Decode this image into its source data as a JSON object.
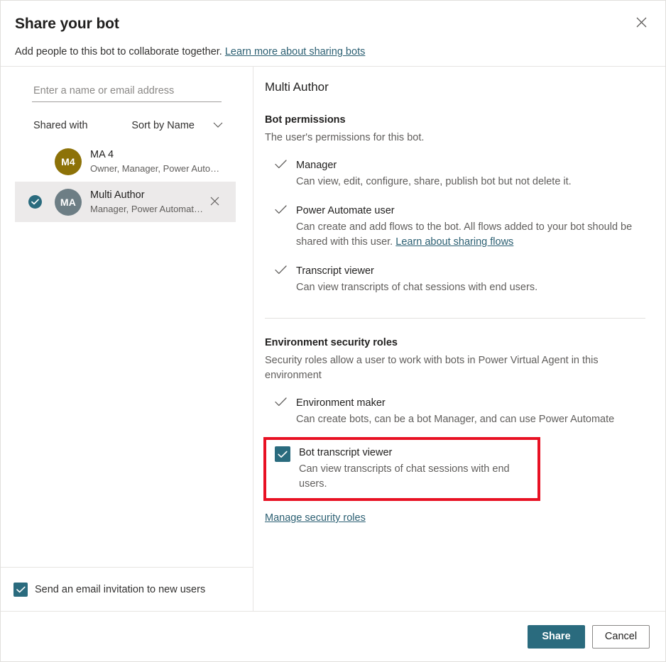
{
  "dialog": {
    "title": "Share your bot",
    "subtitle_text": "Add people to this bot to collaborate together.",
    "subtitle_link": "Learn more about sharing bots",
    "close_icon": "close-icon"
  },
  "left": {
    "people_input_placeholder": "Enter a name or email address",
    "people_input_value": "",
    "shared_with_label": "Shared with",
    "sort_label": "Sort by Name",
    "sort_chevron_icon": "chevron-down-icon",
    "people": [
      {
        "initials": "M4",
        "name": "MA 4",
        "roles": "Owner, Manager, Power Automate us...",
        "avatar_color": "#8d7208",
        "selected": false,
        "removable": false
      },
      {
        "initials": "MA",
        "name": "Multi Author",
        "roles": "Manager, Power Automate user",
        "avatar_color": "#6d7e85",
        "selected": true,
        "removable": true,
        "remove_icon": "close-icon"
      }
    ],
    "email_invite_label": "Send an email invitation to new users",
    "email_invite_checked": true
  },
  "right": {
    "user_title": "Multi Author",
    "bot_permissions": {
      "heading": "Bot permissions",
      "description": "The user's permissions for this bot.",
      "items": [
        {
          "name": "Manager",
          "description": "Can view, edit, configure, share, publish bot but not delete it.",
          "checked": true,
          "mark": "checkmark-icon"
        },
        {
          "name": "Power Automate user",
          "description": "Can create and add flows to the bot. All flows added to your bot should be shared with this user.",
          "link": "Learn about sharing flows",
          "checked": true,
          "mark": "checkmark-icon"
        },
        {
          "name": "Transcript viewer",
          "description": "Can view transcripts of chat sessions with end users.",
          "checked": true,
          "mark": "checkmark-icon"
        }
      ]
    },
    "environment_roles": {
      "heading": "Environment security roles",
      "description": "Security roles allow a user to work with bots in Power Virtual Agent in this environment",
      "items": [
        {
          "name": "Environment maker",
          "description": "Can create bots, can be a bot Manager, and can use Power Automate",
          "checked": true,
          "mark": "checkmark-icon",
          "highlighted": false
        },
        {
          "name": "Bot transcript viewer",
          "description": "Can view transcripts of chat sessions with end users.",
          "checked": true,
          "mark": "checkbox-checked-icon",
          "highlighted": true
        }
      ],
      "manage_link": "Manage security roles"
    }
  },
  "footer": {
    "primary_label": "Share",
    "secondary_label": "Cancel"
  },
  "colors": {
    "accent": "#2a6b7e",
    "link": "#2b5f72",
    "highlight_border": "#e81123",
    "avatar_gold": "#8d7208",
    "avatar_slate": "#6d7e85"
  }
}
